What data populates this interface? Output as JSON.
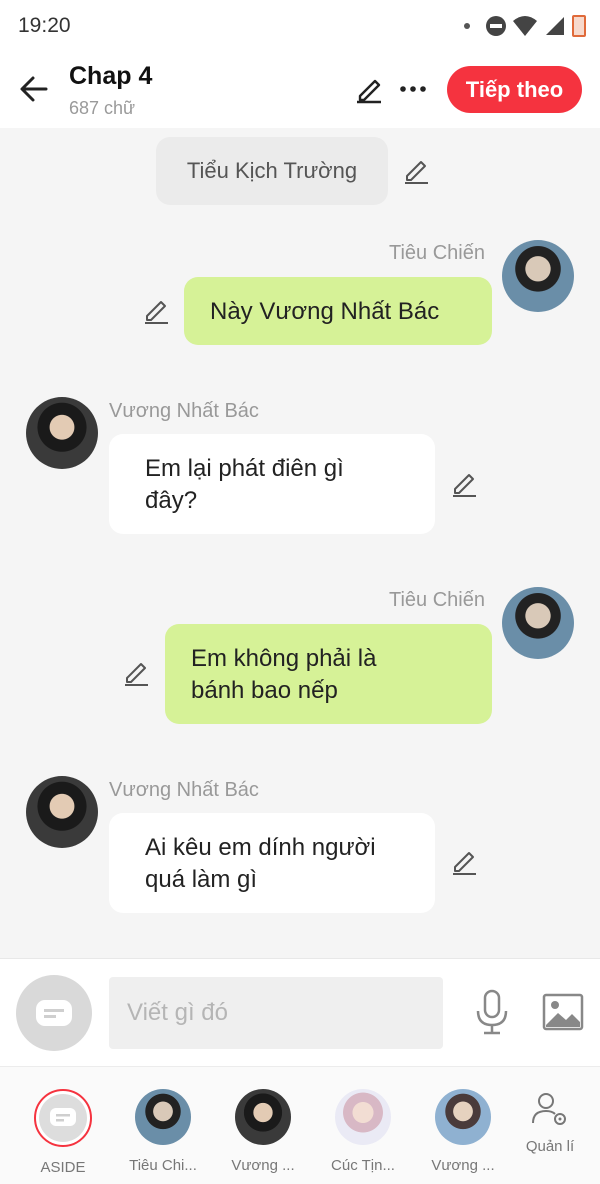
{
  "status_bar": {
    "time": "19:20"
  },
  "header": {
    "title": "Chap 4",
    "subtitle": "687 chữ",
    "next_label": "Tiếp theo"
  },
  "chat": {
    "narration": "Tiểu Kịch Trường",
    "messages": [
      {
        "speaker": "Tiêu Chiến",
        "side": "right",
        "text_lines": [
          "Này Vương Nhất Bác"
        ]
      },
      {
        "speaker": "Vương Nhất Bác",
        "side": "left",
        "text_lines": [
          "Em lại phát điên gì",
          "đây?"
        ]
      },
      {
        "speaker": "Tiêu Chiến",
        "side": "right",
        "text_lines": [
          "Em không phải là",
          "bánh bao nếp"
        ]
      },
      {
        "speaker": "Vương Nhất Bác",
        "side": "left",
        "text_lines": [
          "Ai kêu em dính người",
          "quá làm gì"
        ]
      }
    ]
  },
  "input": {
    "placeholder": "Viết gì đó"
  },
  "characters": [
    {
      "label": "ASIDE"
    },
    {
      "label": "Tiêu Chi..."
    },
    {
      "label": "Vương ..."
    },
    {
      "label": "Cúc Tịn..."
    },
    {
      "label": "Vương ..."
    }
  ],
  "manage_label": "Quản lí",
  "colors": {
    "accent": "#f5333f",
    "right_bubble": "#d6f297",
    "left_bubble": "#ffffff"
  }
}
